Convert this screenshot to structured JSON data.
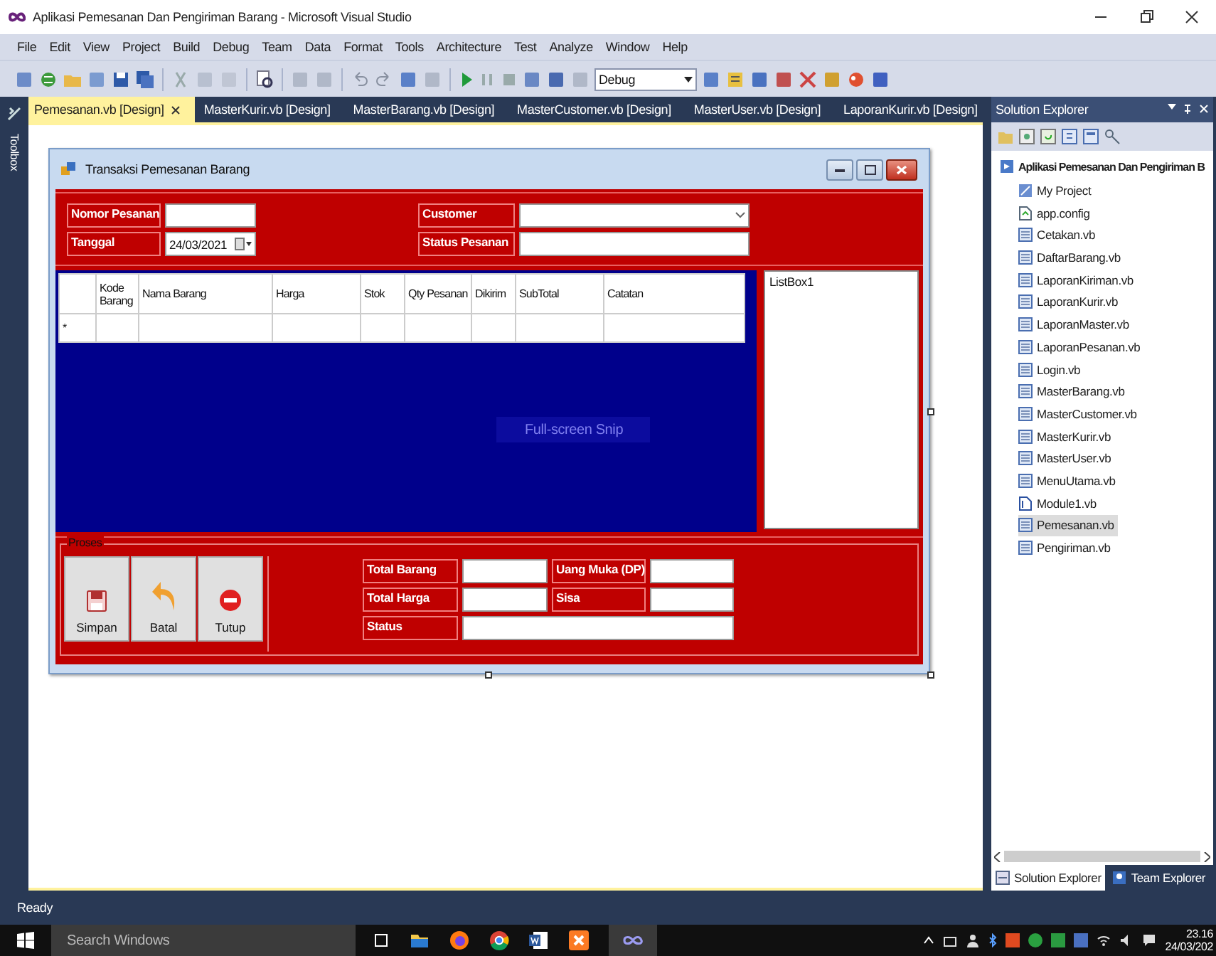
{
  "window": {
    "title": "Aplikasi Pemesanan Dan Pengiriman Barang - Microsoft Visual Studio"
  },
  "menu": [
    "File",
    "Edit",
    "View",
    "Project",
    "Build",
    "Debug",
    "Team",
    "Data",
    "Format",
    "Tools",
    "Architecture",
    "Test",
    "Analyze",
    "Window",
    "Help"
  ],
  "toolbar": {
    "configuration": "Debug"
  },
  "tabs": [
    {
      "label": "Pemesanan.vb [Design]",
      "selected": true
    },
    {
      "label": "MasterKurir.vb [Design]",
      "selected": false
    },
    {
      "label": "MasterBarang.vb [Design]",
      "selected": false
    },
    {
      "label": "MasterCustomer.vb [Design]",
      "selected": false
    },
    {
      "label": "MasterUser.vb [Design]",
      "selected": false
    },
    {
      "label": "LaporanKurir.vb [Design]",
      "selected": false
    }
  ],
  "toolbox": {
    "label": "Toolbox"
  },
  "form": {
    "title": "Transaksi Pemesanan Barang",
    "header_fields": [
      {
        "label": "Nomor Pesanan",
        "kind": "text"
      },
      {
        "label": "Tanggal",
        "kind": "date",
        "value": "24/03/2021"
      },
      {
        "label": "Customer",
        "kind": "combo"
      },
      {
        "label": "Status Pesanan",
        "kind": "text"
      }
    ],
    "grid": {
      "columns": [
        "Kode Barang",
        "Nama Barang",
        "Harga",
        "Stok",
        "Qty Pesanan",
        "Dikirim",
        "SubTotal",
        "Catatan"
      ],
      "new_row_marker": "*"
    },
    "listbox": {
      "label": "ListBox1"
    },
    "snip_hint": "Full-screen Snip",
    "group": {
      "title": "Proses",
      "buttons": [
        {
          "label": "Simpan",
          "kind": "save"
        },
        {
          "label": "Batal",
          "kind": "undo"
        },
        {
          "label": "Tutup",
          "kind": "stop"
        }
      ],
      "summary_fields": [
        {
          "label": "Total Barang"
        },
        {
          "label": "Uang Muka (DP)"
        },
        {
          "label": "Total Harga"
        },
        {
          "label": "Sisa"
        },
        {
          "label": "Status"
        }
      ]
    }
  },
  "solution_explorer": {
    "title": "Solution Explorer",
    "project": "Aplikasi Pemesanan Dan Pengiriman B",
    "items": [
      {
        "label": "My Project",
        "kind": "project",
        "selected": false
      },
      {
        "label": "app.config",
        "kind": "config",
        "selected": false
      },
      {
        "label": "Cetakan.vb",
        "kind": "form",
        "selected": false
      },
      {
        "label": "DaftarBarang.vb",
        "kind": "form",
        "selected": false
      },
      {
        "label": "LaporanKiriman.vb",
        "kind": "form",
        "selected": false
      },
      {
        "label": "LaporanKurir.vb",
        "kind": "form",
        "selected": false
      },
      {
        "label": "LaporanMaster.vb",
        "kind": "form",
        "selected": false
      },
      {
        "label": "LaporanPesanan.vb",
        "kind": "form",
        "selected": false
      },
      {
        "label": "Login.vb",
        "kind": "form",
        "selected": false
      },
      {
        "label": "MasterBarang.vb",
        "kind": "form",
        "selected": false
      },
      {
        "label": "MasterCustomer.vb",
        "kind": "form",
        "selected": false
      },
      {
        "label": "MasterKurir.vb",
        "kind": "form",
        "selected": false
      },
      {
        "label": "MasterUser.vb",
        "kind": "form",
        "selected": false
      },
      {
        "label": "MenuUtama.vb",
        "kind": "form",
        "selected": false
      },
      {
        "label": "Module1.vb",
        "kind": "module",
        "selected": false
      },
      {
        "label": "Pemesanan.vb",
        "kind": "form",
        "selected": true
      },
      {
        "label": "Pengiriman.vb",
        "kind": "form",
        "selected": false
      }
    ],
    "tabs": [
      {
        "label": "Solution Explorer",
        "selected": true
      },
      {
        "label": "Team Explorer",
        "selected": false
      }
    ]
  },
  "status_bar": {
    "text": "Ready"
  },
  "taskbar": {
    "search_placeholder": "Search Windows",
    "time": "23.16",
    "date": "24/03/202"
  }
}
